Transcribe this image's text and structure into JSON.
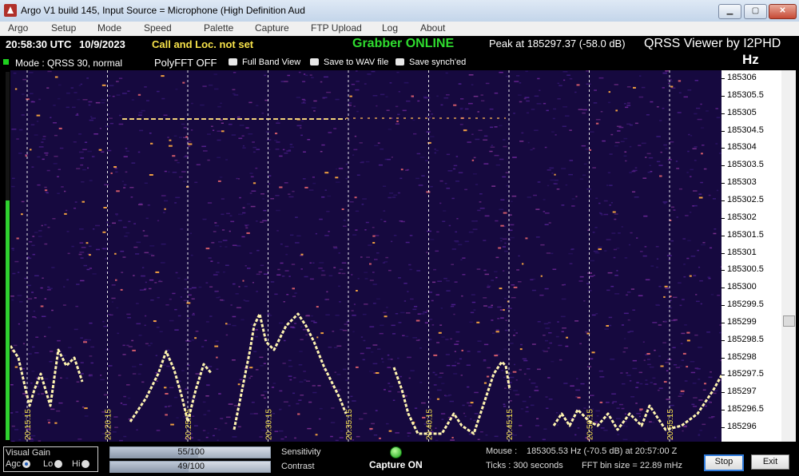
{
  "window": {
    "title": "Argo V1 build 145, Input Source = Microphone (High Definition Aud",
    "minimize_icon": "minimize-icon",
    "maximize_icon": "maximize-icon",
    "close_icon": "close-icon"
  },
  "menu": [
    "Argo",
    "Setup",
    "Mode",
    "Speed",
    "Palette",
    "Capture",
    "FTP Upload",
    "Log",
    "About"
  ],
  "header": {
    "time_utc": "20:58:30 UTC",
    "date": "10/9/2023",
    "call_status": "Call and Loc. not set",
    "grabber_status": "Grabber ONLINE",
    "peak": "Peak at  185297.37 (-58.0 dB)",
    "brand": "QRSS Viewer by I2PHD",
    "mode": "Mode : QRSS 30, normal",
    "polyfft": "PolyFFT OFF",
    "full_band_view": "Full Band View",
    "save_wav": "Save to WAV file",
    "save_synched": "Save synch'ed",
    "units": "Hz"
  },
  "freq_axis": {
    "labels": [
      "185306",
      "185305.5",
      "185305",
      "185304.5",
      "185304",
      "185303.5",
      "185303",
      "185302.5",
      "185302",
      "185301.5",
      "185301",
      "185300.5",
      "185300",
      "185299.5",
      "185299",
      "185298.5",
      "185298",
      "185297.5",
      "185297",
      "185296.5",
      "185296"
    ]
  },
  "time_axis": {
    "labels": [
      "20:15:15",
      "20:20:15",
      "20:25:15",
      "20:30:15",
      "20:35:15",
      "20:40:15",
      "20:45:15",
      "20:50:15",
      "20:55:15"
    ]
  },
  "left_level": 0.65,
  "freq_scroll_position": 0.66,
  "colors": {
    "background": "#16093f",
    "signal": "#fff4b0",
    "green": "#2fdc2f",
    "yellow": "#f6e24a"
  },
  "bottom": {
    "visual_gain": "Visual Gain",
    "agc": "Agc",
    "lo": "Lo",
    "hi": "Hi",
    "sensitivity_value": "55/100",
    "sensitivity": 0.55,
    "sensitivity_label": "Sensitivity",
    "contrast_value": "49/100",
    "contrast": 0.49,
    "contrast_label": "Contrast",
    "capture_status": "Capture ON",
    "mouse_label": "Mouse :",
    "mouse_value": "185305.53 Hz  (-70.5 dB) at 20:57:00 Z",
    "ticks": "Ticks  : 300 seconds",
    "fft_bin": "FFT bin size = 22.89 mHz",
    "stop": "Stop",
    "exit": "Exit"
  }
}
